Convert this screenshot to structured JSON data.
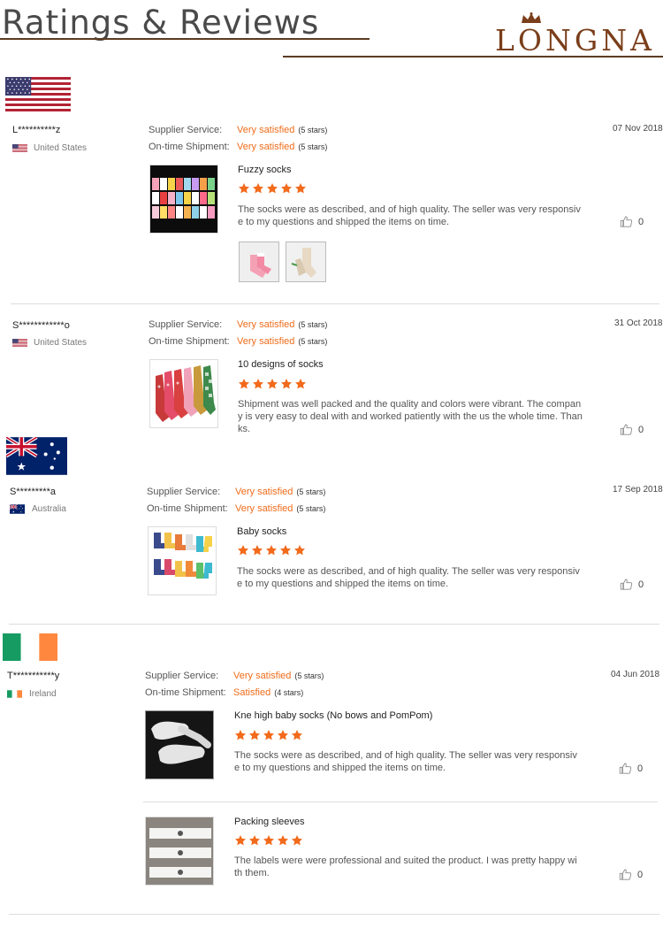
{
  "header": {
    "title": "Ratings & Reviews",
    "logo_text": "LONGNA"
  },
  "labels": {
    "supplier_service": "Supplier Service:",
    "ontime_shipment": "On-time Shipment:"
  },
  "reviews": [
    {
      "reviewer": "L**********z",
      "country": "United States",
      "date": "07 Nov 2018",
      "supplier_value": "Very satisfied",
      "supplier_stars": "(5 stars)",
      "shipment_value": "Very satisfied",
      "shipment_stars": "(5 stars)",
      "items": [
        {
          "product": "Fuzzy socks",
          "rating": 5,
          "text": "The socks were as described, and of high quality. The seller was very responsive to my questions and shipped the items on time.",
          "likes": "0"
        }
      ]
    },
    {
      "reviewer": "S************o",
      "country": "United States",
      "date": "31 Oct 2018",
      "supplier_value": "Very satisfied",
      "supplier_stars": "(5 stars)",
      "shipment_value": "Very satisfied",
      "shipment_stars": "(5 stars)",
      "items": [
        {
          "product": "10 designs of socks",
          "rating": 5,
          "text": "Shipment was well packed and the quality and colors were vibrant. The company is very easy to deal with and worked patiently with the us the whole time. Thanks.",
          "likes": "0"
        }
      ]
    },
    {
      "reviewer": "S*********a",
      "country": "Australia",
      "date": "17 Sep 2018",
      "supplier_value": "Very satisfied",
      "supplier_stars": "(5 stars)",
      "shipment_value": "Very satisfied",
      "shipment_stars": "(5 stars)",
      "items": [
        {
          "product": "Baby socks",
          "rating": 5,
          "text": "The socks were as described, and of high quality. The seller was very responsive to my questions and shipped the items on time.",
          "likes": "0"
        }
      ]
    },
    {
      "reviewer": "T***********y",
      "country": "Ireland",
      "date": "04 Jun 2018",
      "supplier_value": "Very satisfied",
      "supplier_stars": "(5 stars)",
      "shipment_value": "Satisfied",
      "shipment_stars": "(4 stars)",
      "items": [
        {
          "product": "Kne high baby socks (No bows and PomPom)",
          "rating": 5,
          "text": "The socks were as described, and of high quality. The seller was very responsive to my questions and shipped the items on time.",
          "likes": "0"
        },
        {
          "product": "Packing sleeves",
          "rating": 5,
          "text": "The labels were were professional and suited the product. I was pretty happy with them.",
          "likes": "0"
        }
      ]
    }
  ],
  "colors": {
    "accent": "#ef6c1a",
    "brand": "#7a3e1a"
  }
}
